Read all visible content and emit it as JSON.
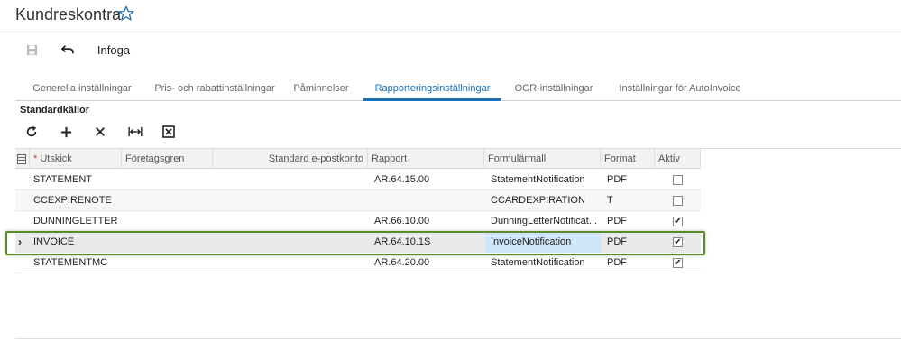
{
  "header": {
    "title": "Kundreskontra"
  },
  "toolbar": {
    "insert_label": "Infoga"
  },
  "tabs": [
    {
      "label": "Generella inställningar"
    },
    {
      "label": "Pris- och rabattinställningar"
    },
    {
      "label": "Påminnelser"
    },
    {
      "label": "Rapporteringsinställningar",
      "active": true
    },
    {
      "label": "OCR-inställningar"
    },
    {
      "label": "Inställningar för AutoInvoice"
    }
  ],
  "section": {
    "title": "Standardkällor"
  },
  "grid": {
    "columns": {
      "utskick": "Utskick",
      "foretagsgren": "Företagsgren",
      "epost": "Standard e-postkonto",
      "rapport": "Rapport",
      "formularmall": "Formulärmall",
      "format": "Format",
      "aktiv": "Aktiv"
    },
    "rows": [
      {
        "utskick": "STATEMENT",
        "foretagsgren": "",
        "epost": "",
        "rapport": "AR.64.15.00",
        "formularmall": "StatementNotification",
        "format": "PDF",
        "aktiv": false
      },
      {
        "utskick": "CCEXPIRENOTE",
        "foretagsgren": "",
        "epost": "",
        "rapport": "",
        "formularmall": "CCARDEXPIRATION",
        "format": "T",
        "aktiv": false
      },
      {
        "utskick": "DUNNINGLETTER",
        "foretagsgren": "",
        "epost": "",
        "rapport": "AR.66.10.00",
        "formularmall": "DunningLetterNotificat...",
        "format": "PDF",
        "aktiv": true
      },
      {
        "utskick": "INVOICE",
        "foretagsgren": "",
        "epost": "",
        "rapport": "AR.64.10.1S",
        "formularmall": "InvoiceNotification",
        "format": "PDF",
        "aktiv": true
      },
      {
        "utskick": "STATEMENTMC",
        "foretagsgren": "",
        "epost": "",
        "rapport": "AR.64.20.00",
        "formularmall": "StatementNotification",
        "format": "PDF",
        "aktiv": true
      }
    ]
  },
  "colors": {
    "accent": "#1a6fb5",
    "selection_outline": "#5b8a2a",
    "cell_highlight": "#cfe6f8"
  }
}
